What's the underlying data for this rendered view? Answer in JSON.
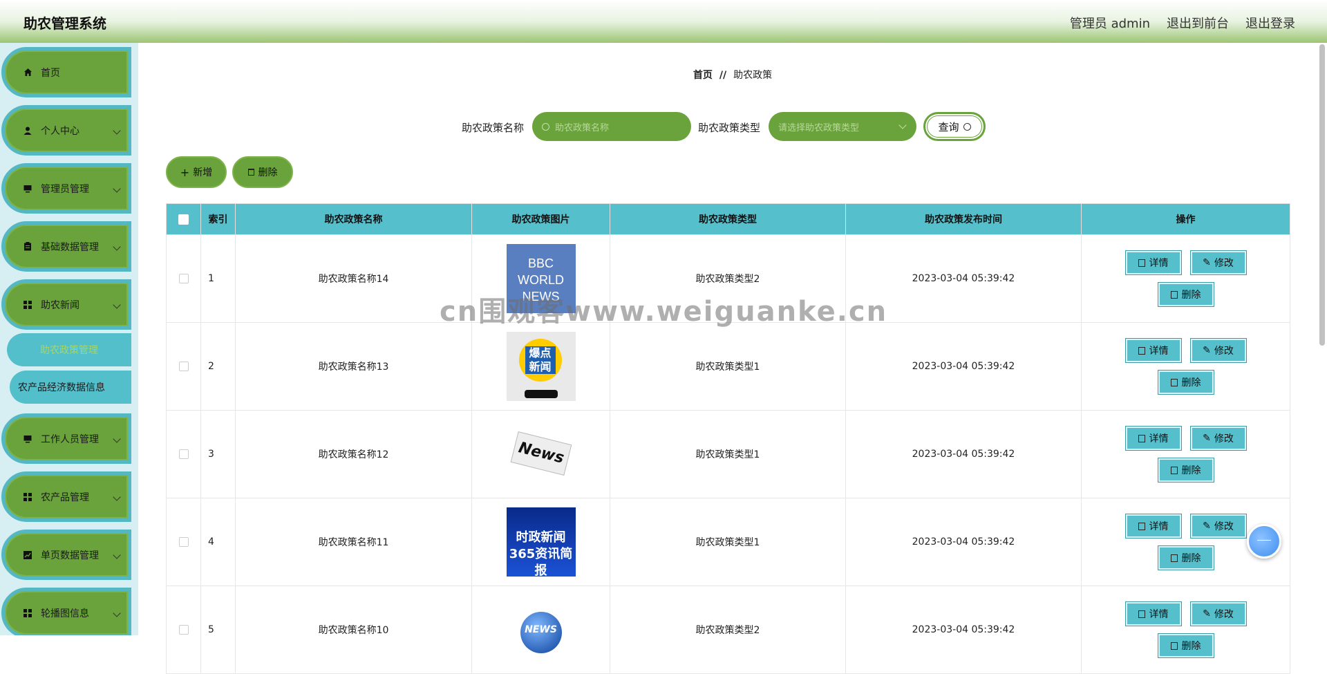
{
  "header": {
    "title": "助农管理系统",
    "user": "管理员 admin",
    "front": "退出到前台",
    "logout": "退出登录"
  },
  "sidebar": {
    "items": [
      {
        "label": "首页",
        "icon": "home-icon"
      },
      {
        "label": "个人中心",
        "icon": "user-icon"
      },
      {
        "label": "管理员管理",
        "icon": "monitor-icon"
      },
      {
        "label": "基础数据管理",
        "icon": "clipboard-icon"
      },
      {
        "label": "助农新闻",
        "icon": "grid-icon"
      },
      {
        "label": "工作人员管理",
        "icon": "monitor-icon"
      },
      {
        "label": "农产品管理",
        "icon": "grid-icon"
      },
      {
        "label": "单页数据管理",
        "icon": "chart-icon"
      },
      {
        "label": "轮播图信息",
        "icon": "grid-icon"
      }
    ],
    "sub_active": "助农政策管理",
    "sub_normal": "农产品经济数据信息"
  },
  "breadcrumb": {
    "home": "首页",
    "sep": "//",
    "current": "助农政策"
  },
  "search": {
    "name_label": "助农政策名称",
    "name_placeholder": "助农政策名称",
    "type_label": "助农政策类型",
    "type_placeholder": "请选择助农政策类型",
    "query": "查询"
  },
  "actions": {
    "add": "新增",
    "delete": "删除"
  },
  "table": {
    "headers": [
      "索引",
      "助农政策名称",
      "助农政策图片",
      "助农政策类型",
      "助农政策发布时间",
      "操作"
    ],
    "rows": [
      {
        "idx": "1",
        "name": "助农政策名称14",
        "type": "助农政策类型2",
        "time": "2023-03-04 05:39:42",
        "img_text": "BBC WORLD NEWS"
      },
      {
        "idx": "2",
        "name": "助农政策名称13",
        "type": "助农政策类型1",
        "time": "2023-03-04 05:39:42",
        "img_text": "爆点新闻"
      },
      {
        "idx": "3",
        "name": "助农政策名称12",
        "type": "助农政策类型1",
        "time": "2023-03-04 05:39:42",
        "img_text": "News"
      },
      {
        "idx": "4",
        "name": "助农政策名称11",
        "type": "助农政策类型1",
        "time": "2023-03-04 05:39:42",
        "img_text": "时政新闻 365资讯简报"
      },
      {
        "idx": "5",
        "name": "助农政策名称10",
        "type": "助农政策类型2",
        "time": "2023-03-04 05:39:42",
        "img_text": "NEWS"
      }
    ],
    "ops": {
      "detail": "详情",
      "edit": "修改",
      "delete": "删除"
    }
  },
  "watermark": "cn围观客www.weiguanke.cn",
  "colors": {
    "green": "#6aa33b",
    "teal": "#55bfcb",
    "sidebar_bg": "#d7eef2"
  }
}
